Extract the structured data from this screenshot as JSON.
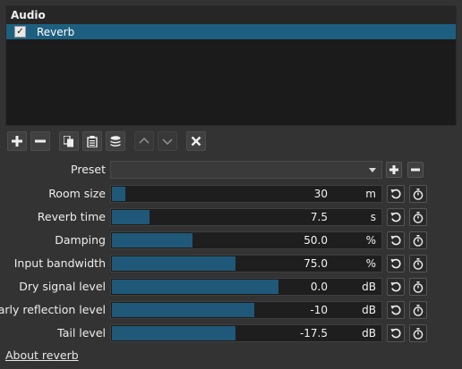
{
  "panel": {
    "title": "Audio",
    "filters": [
      {
        "label": "Reverb",
        "checked": true,
        "check_glyph": "✓"
      }
    ]
  },
  "toolbar": {
    "buttons": [
      {
        "name": "add-filter-button",
        "icon": "plus-icon"
      },
      {
        "name": "remove-filter-button",
        "icon": "minus-icon"
      },
      {
        "name": "copy-filters-button",
        "icon": "copy-icon"
      },
      {
        "name": "paste-filters-button",
        "icon": "paste-icon"
      },
      {
        "name": "save-preset-button",
        "icon": "stack-icon"
      },
      {
        "name": "move-up-button",
        "icon": "chevron-up-icon"
      },
      {
        "name": "move-down-button",
        "icon": "chevron-down-icon"
      },
      {
        "name": "deselect-filter-button",
        "icon": "close-icon"
      }
    ]
  },
  "preset": {
    "label": "Preset",
    "value": ""
  },
  "params": [
    {
      "label": "Room size",
      "value": "30",
      "unit": "m",
      "fraction": 0.05
    },
    {
      "label": "Reverb time",
      "value": "7.5",
      "unit": "s",
      "fraction": 0.14
    },
    {
      "label": "Damping",
      "value": "50.0",
      "unit": "%",
      "fraction": 0.3
    },
    {
      "label": "Input bandwidth",
      "value": "75.0",
      "unit": "%",
      "fraction": 0.46
    },
    {
      "label": "Dry signal level",
      "value": "0.0",
      "unit": "dB",
      "fraction": 0.62
    },
    {
      "label": "Early reflection level",
      "value": "-10",
      "unit": "dB",
      "fraction": 0.53
    },
    {
      "label": "Tail level",
      "value": "-17.5",
      "unit": "dB",
      "fraction": 0.46
    }
  ],
  "about_link": "About reverb",
  "colors": {
    "accent": "#1d5f7e",
    "slider_fill": "#1f5878",
    "background": "#333333"
  }
}
